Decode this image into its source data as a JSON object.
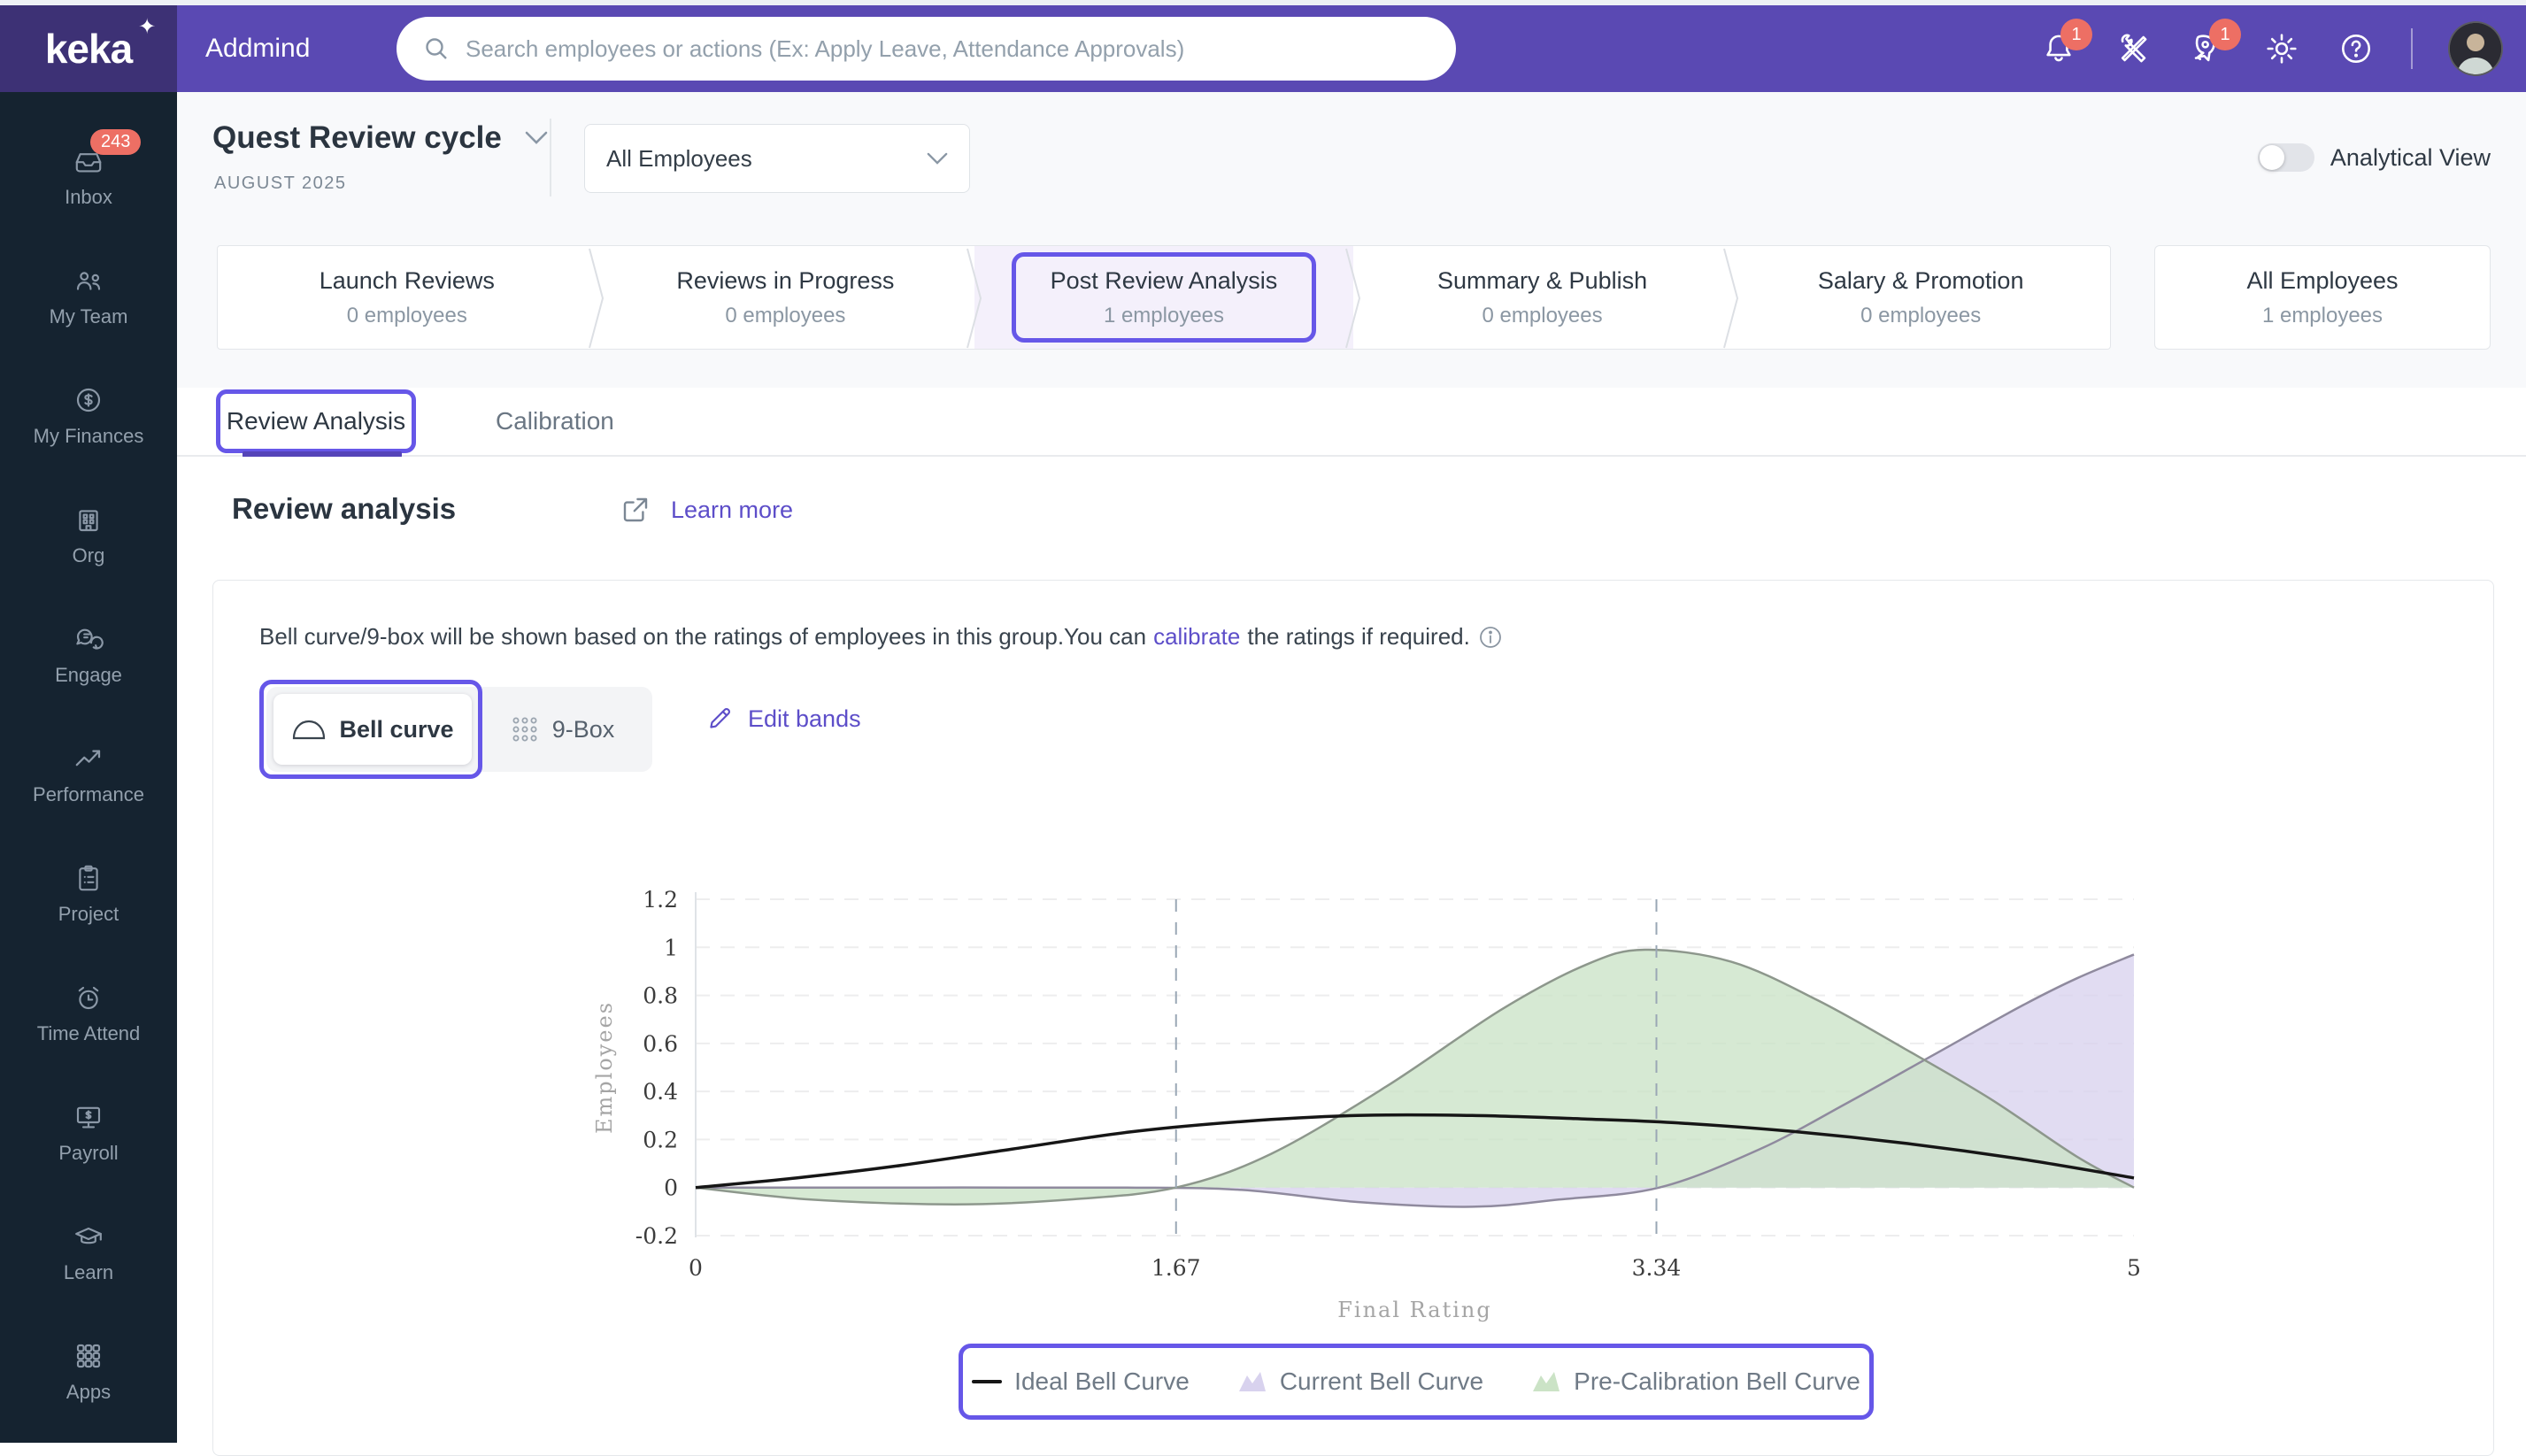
{
  "brand": {
    "logo": "keka",
    "spark": "✦",
    "org": "Addmind"
  },
  "topbar": {
    "search_placeholder": "Search employees or actions (Ex: Apply Leave, Attendance Approvals)",
    "bell_badge": "1",
    "news_badge": "1"
  },
  "sidebar": {
    "inbox_badge": "243",
    "items": [
      {
        "label": "Inbox"
      },
      {
        "label": "My Team"
      },
      {
        "label": "My Finances"
      },
      {
        "label": "Org"
      },
      {
        "label": "Engage"
      },
      {
        "label": "Performance"
      },
      {
        "label": "Project"
      },
      {
        "label": "Time Attend"
      },
      {
        "label": "Payroll"
      },
      {
        "label": "Learn"
      },
      {
        "label": "Apps"
      }
    ]
  },
  "header": {
    "cycle_title": "Quest Review cycle",
    "cycle_period": "AUGUST 2025",
    "group_filter": "All Employees",
    "analytical_toggle_label": "Analytical View"
  },
  "pipeline": {
    "stages": [
      {
        "label": "Launch Reviews",
        "count": "0 employees"
      },
      {
        "label": "Reviews in Progress",
        "count": "0 employees"
      },
      {
        "label": "Post Review Analysis",
        "count": "1 employees"
      },
      {
        "label": "Summary & Publish",
        "count": "0 employees"
      },
      {
        "label": "Salary & Promotion",
        "count": "0 employees"
      }
    ],
    "all_card": {
      "label": "All Employees",
      "count": "1 employees"
    }
  },
  "tabs": {
    "review_analysis": "Review Analysis",
    "calibration": "Calibration"
  },
  "section": {
    "title": "Review analysis",
    "learn_more": "Learn more"
  },
  "panel": {
    "desc_prefix": "Bell curve/9-box will be shown based on the ratings of employees in this group.You can ",
    "desc_link": "calibrate",
    "desc_suffix": " the ratings if required.",
    "bell_curve": "Bell curve",
    "nine_box": "9-Box",
    "edit_bands": "Edit bands"
  },
  "chart_data": {
    "type": "area",
    "xlabel": "Final Rating",
    "ylabel": "Employees",
    "xlim": [
      0,
      5
    ],
    "ylim": [
      -0.2,
      1.2
    ],
    "xticks": [
      0,
      1.67,
      3.34,
      5
    ],
    "yticks": [
      -0.2,
      0,
      0.2,
      0.4,
      0.6,
      0.8,
      1,
      1.2
    ],
    "guides_x": [
      1.67,
      3.34
    ],
    "grid": "dashed-horizontal",
    "legend_position": "bottom",
    "series": [
      {
        "name": "Ideal Bell Curve",
        "type": "line",
        "color": "#161616",
        "points": [
          [
            0,
            0
          ],
          [
            0.35,
            0.04
          ],
          [
            0.7,
            0.09
          ],
          [
            1.1,
            0.16
          ],
          [
            1.5,
            0.23
          ],
          [
            1.9,
            0.275
          ],
          [
            2.3,
            0.3
          ],
          [
            2.7,
            0.3
          ],
          [
            3.1,
            0.285
          ],
          [
            3.4,
            0.27
          ],
          [
            3.8,
            0.235
          ],
          [
            4.2,
            0.185
          ],
          [
            4.6,
            0.12
          ],
          [
            5,
            0.04
          ]
        ]
      },
      {
        "name": "Current Bell Curve",
        "type": "area",
        "fill": "#d8d2ee",
        "stroke": "#8f8a9e",
        "points": [
          [
            0,
            0
          ],
          [
            0.8,
            0
          ],
          [
            1.5,
            0
          ],
          [
            1.9,
            -0.01
          ],
          [
            2.3,
            -0.06
          ],
          [
            2.7,
            -0.08
          ],
          [
            3.0,
            -0.05
          ],
          [
            3.35,
            0
          ],
          [
            3.7,
            0.16
          ],
          [
            4.0,
            0.35
          ],
          [
            4.3,
            0.55
          ],
          [
            4.6,
            0.75
          ],
          [
            4.8,
            0.87
          ],
          [
            5,
            0.97
          ]
        ]
      },
      {
        "name": "Pre-Calibration Bell Curve",
        "type": "area",
        "fill": "#cbe3c6",
        "stroke": "#8d978c",
        "points": [
          [
            0,
            0
          ],
          [
            0.4,
            -0.05
          ],
          [
            0.9,
            -0.07
          ],
          [
            1.3,
            -0.05
          ],
          [
            1.67,
            0
          ],
          [
            2.0,
            0.14
          ],
          [
            2.4,
            0.42
          ],
          [
            2.8,
            0.74
          ],
          [
            3.1,
            0.93
          ],
          [
            3.3,
            0.99
          ],
          [
            3.6,
            0.94
          ],
          [
            3.9,
            0.78
          ],
          [
            4.2,
            0.58
          ],
          [
            4.5,
            0.37
          ],
          [
            4.8,
            0.13
          ],
          [
            5,
            0
          ]
        ]
      }
    ]
  }
}
